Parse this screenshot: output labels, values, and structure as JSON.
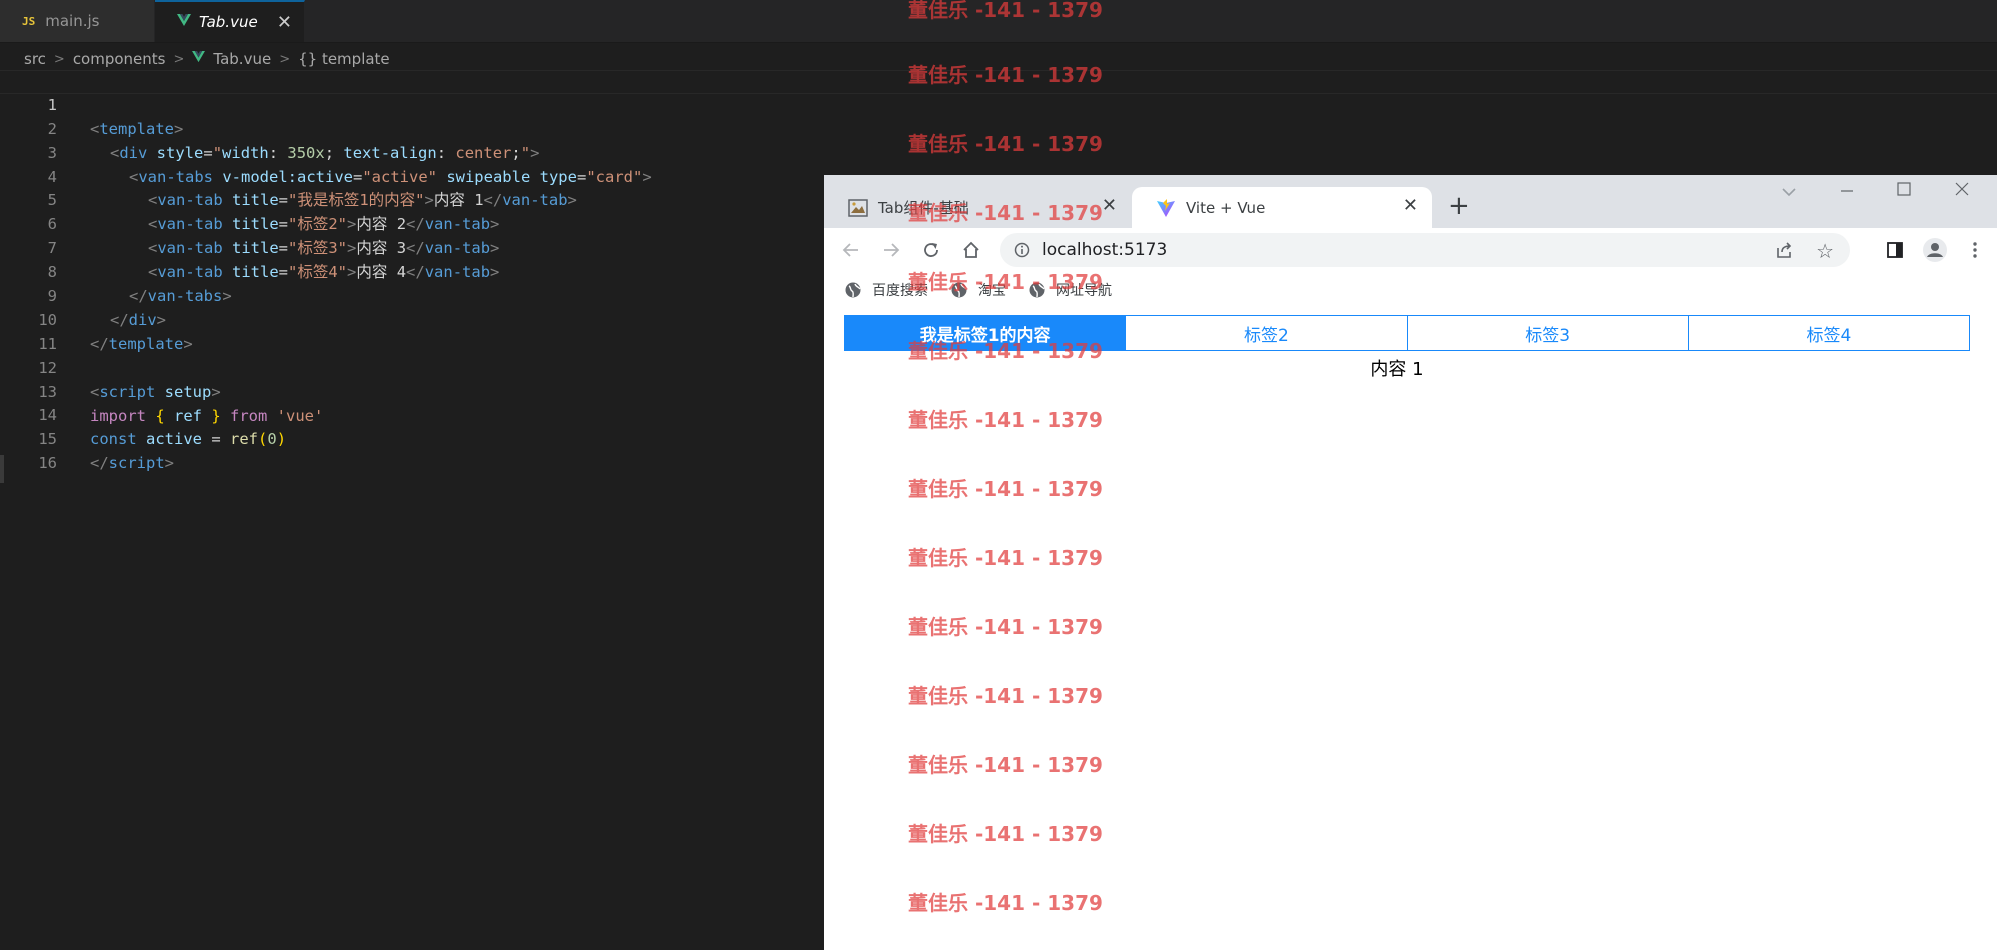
{
  "editor": {
    "tabs": [
      {
        "badge": "JS",
        "label": "main.js"
      },
      {
        "label": "Tab.vue",
        "close": "✕"
      }
    ],
    "breadcrumb": {
      "items": [
        "src",
        "components",
        "Tab.vue",
        "{} template"
      ],
      "sep": ">"
    },
    "line_numbers": [
      "1",
      "2",
      "3",
      "4",
      "5",
      "6",
      "7",
      "8",
      "9",
      "10",
      "11",
      "12",
      "13",
      "14",
      "15",
      "16"
    ],
    "code": {
      "l1": {
        "t1": "<",
        "t2": "template",
        "t3": ">"
      },
      "l2": {
        "t1": "<",
        "t2": "div",
        "t3": " style",
        "t4": "=",
        "t5": "\"",
        "t6": "width",
        "t7": ": ",
        "t8": "350x",
        "t9": "; ",
        "t10": "text-align",
        "t11": ": ",
        "t12": "center",
        "t13": ";",
        "t14": "\"",
        "t15": ">"
      },
      "l3": {
        "t1": "<",
        "t2": "van-tabs",
        "t3": " v-model:active",
        "t4": "=",
        "t5": "\"active\"",
        "t6": " swipeable",
        "t7": " type",
        "t8": "=",
        "t9": "\"card\"",
        "t10": ">"
      },
      "l4": {
        "t1": "<",
        "t2": "van-tab",
        "t3": " title",
        "t4": "=",
        "t5": "\"我是标签1的内容\"",
        "t6": ">",
        "t7": "内容 1",
        "t8": "</",
        "t9": "van-tab",
        "t10": ">"
      },
      "l5": {
        "t1": "<",
        "t2": "van-tab",
        "t3": " title",
        "t4": "=",
        "t5": "\"标签2\"",
        "t6": ">",
        "t7": "内容 2",
        "t8": "</",
        "t9": "van-tab",
        "t10": ">"
      },
      "l6": {
        "t1": "<",
        "t2": "van-tab",
        "t3": " title",
        "t4": "=",
        "t5": "\"标签3\"",
        "t6": ">",
        "t7": "内容 3",
        "t8": "</",
        "t9": "van-tab",
        "t10": ">"
      },
      "l7": {
        "t1": "<",
        "t2": "van-tab",
        "t3": " title",
        "t4": "=",
        "t5": "\"标签4\"",
        "t6": ">",
        "t7": "内容 4",
        "t8": "</",
        "t9": "van-tab",
        "t10": ">"
      },
      "l8": {
        "t1": "</",
        "t2": "van-tabs",
        "t3": ">"
      },
      "l9": {
        "t1": "</",
        "t2": "div",
        "t3": ">"
      },
      "l10": {
        "t1": "</",
        "t2": "template",
        "t3": ">"
      },
      "l12": {
        "t1": "<",
        "t2": "script",
        "t3": " setup",
        "t4": ">"
      },
      "l13": {
        "t1": "import",
        "t2": " { ",
        "t3": "ref",
        "t4": " } ",
        "t5": "from",
        "t6": " 'vue'"
      },
      "l14": {
        "t1": "const",
        "t2": " active",
        "t3": " = ",
        "t4": "ref",
        "t5": "(",
        "t6": "0",
        "t7": ")"
      },
      "l15": {
        "t1": "</",
        "t2": "script",
        "t3": ">"
      }
    }
  },
  "browser": {
    "tabs": [
      {
        "label": "Tab组件-基础",
        "close": "✕"
      },
      {
        "label": "Vite + Vue",
        "close": "✕"
      }
    ],
    "new_tab": "+",
    "url": "localhost:5173",
    "bookmarks": [
      "百度搜索",
      "淘宝",
      "网址导航"
    ],
    "icons": {
      "back": "arrow-left-icon",
      "forward": "arrow-right-icon",
      "reload": "reload-icon",
      "home": "home-icon",
      "info": "info-icon",
      "share": "share-icon",
      "star": "star-icon",
      "sidepanel": "side-panel-icon",
      "profile": "profile-icon",
      "menu": "kebab-menu-icon"
    }
  },
  "page": {
    "tabs": [
      "我是标签1的内容",
      "标签2",
      "标签3",
      "标签4"
    ],
    "active_index": 0,
    "content": "内容 1"
  },
  "watermark": {
    "text": "董佳乐 -141 - 1379"
  },
  "colors": {
    "accent": "#1989fa",
    "editor_bg": "#1e1e1e",
    "watermark": "#e03c3c"
  }
}
